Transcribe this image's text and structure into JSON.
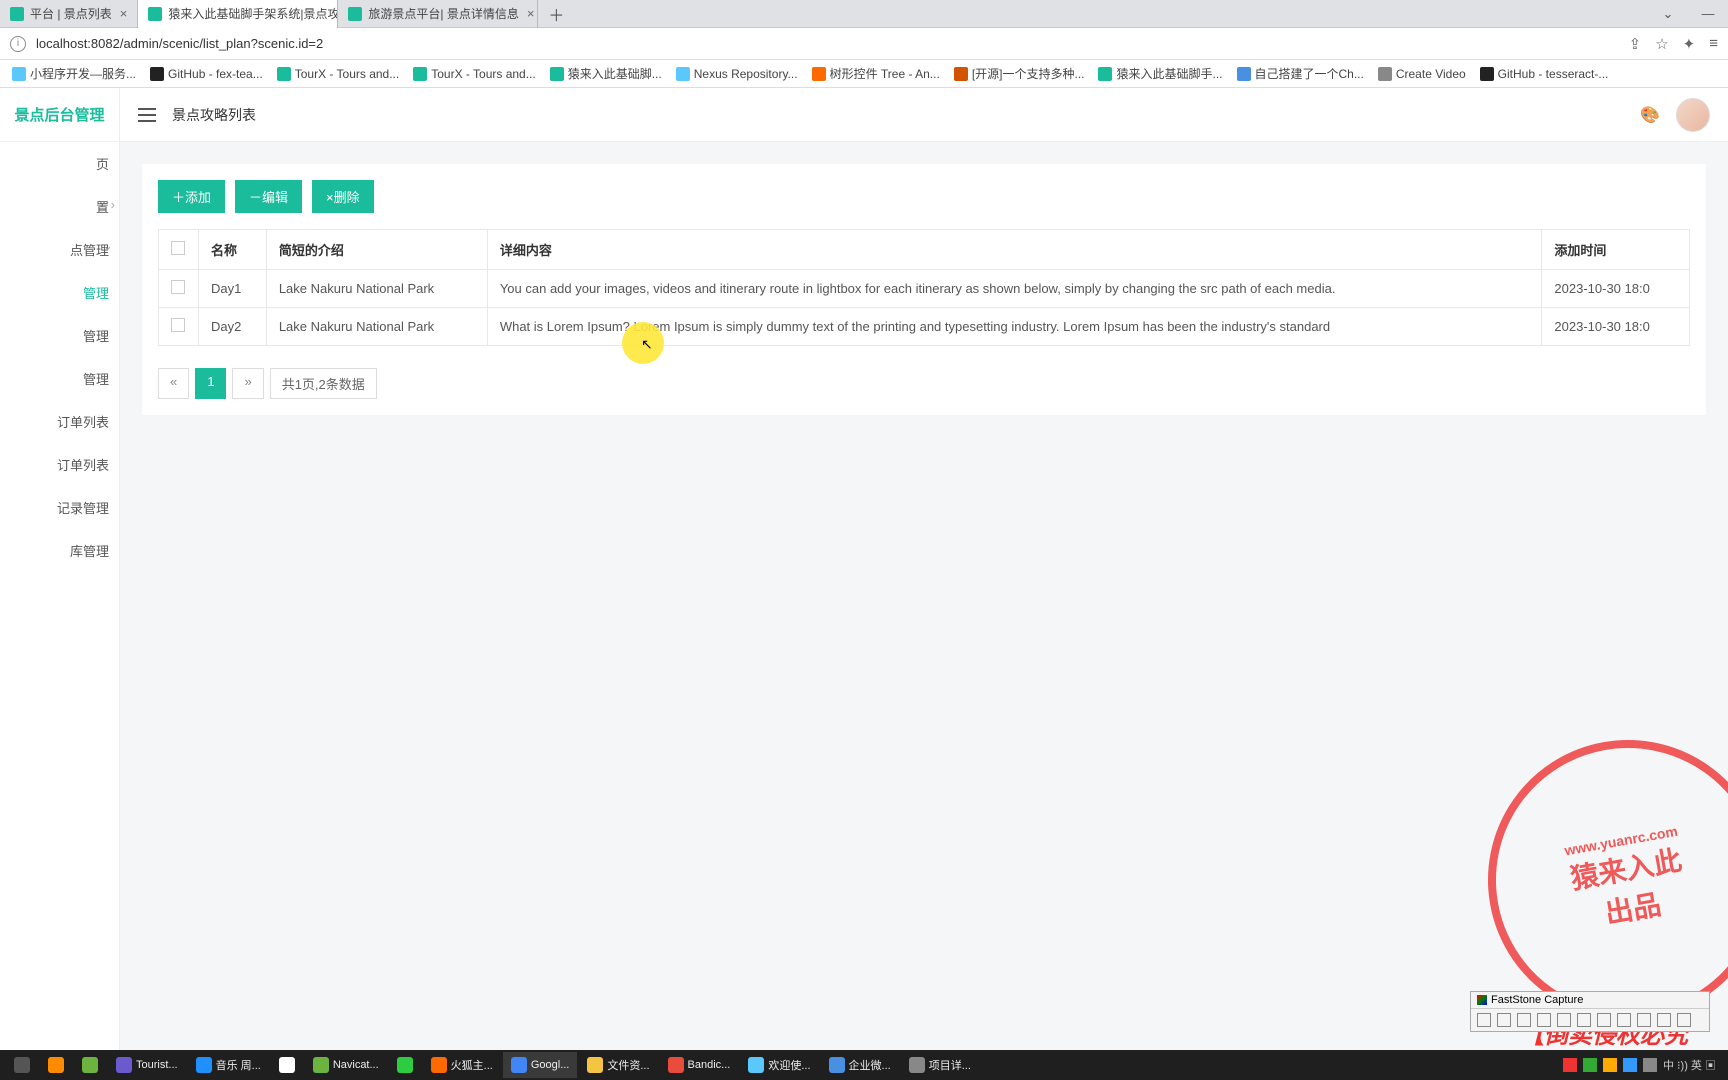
{
  "tabs": [
    {
      "title": "平台 | 景点列表",
      "active": false
    },
    {
      "title": "猿来入此基础脚手架系统|景点攻",
      "active": true
    },
    {
      "title": "旅游景点平台| 景点详情信息",
      "active": false
    }
  ],
  "url": "localhost:8082/admin/scenic/list_plan?scenic.id=2",
  "bookmarks": [
    {
      "label": "小程序开发—服务...",
      "color": "#5ac8fa"
    },
    {
      "label": "GitHub - fex-tea...",
      "color": "#222"
    },
    {
      "label": "TourX - Tours and...",
      "color": "#1abc9c"
    },
    {
      "label": "TourX - Tours and...",
      "color": "#1abc9c"
    },
    {
      "label": "猿来入此基础脚...",
      "color": "#1abc9c"
    },
    {
      "label": "Nexus Repository...",
      "color": "#5ac8fa"
    },
    {
      "label": "树形控件 Tree - An...",
      "color": "#ff6a00"
    },
    {
      "label": "[开源]一个支持多种...",
      "color": "#d35400"
    },
    {
      "label": "猿来入此基础脚手...",
      "color": "#1abc9c"
    },
    {
      "label": "自己搭建了一个Ch...",
      "color": "#4a90e2"
    },
    {
      "label": "Create Video",
      "color": "#888"
    },
    {
      "label": "GitHub - tesseract-...",
      "color": "#222"
    }
  ],
  "logo": "景点后台管理",
  "breadcrumb": "景点攻略列表",
  "sidebar": {
    "items": [
      {
        "label": "页",
        "sub": false
      },
      {
        "label": "置",
        "sub": false,
        "hasSub": true
      },
      {
        "label": "点管理",
        "sub": false,
        "hasSub": true,
        "open": true
      },
      {
        "label": "管理",
        "sub": true,
        "active": true
      },
      {
        "label": "管理",
        "sub": true
      },
      {
        "label": "管理",
        "sub": true
      },
      {
        "label": "订单列表",
        "sub": true
      },
      {
        "label": "订单列表",
        "sub": true
      },
      {
        "label": "记录管理",
        "sub": true
      },
      {
        "label": "库管理",
        "sub": true
      }
    ]
  },
  "buttons": {
    "add": "＋添加",
    "edit": "－编辑",
    "del": "×删除"
  },
  "table": {
    "headers": [
      "",
      "名称",
      "简短的介绍",
      "详细内容",
      "添加时间"
    ],
    "rows": [
      {
        "name": "Day1",
        "intro": "Lake Nakuru National Park",
        "detail": "You can add your images, videos and itinerary route in lightbox for each itinerary as shown below, simply by changing the src path of each media.",
        "time": "2023-10-30 18:0"
      },
      {
        "name": "Day2",
        "intro": "Lake Nakuru National Park",
        "detail": "What is Lorem Ipsum? Lorem Ipsum is simply dummy text of the printing and typesetting industry. Lorem Ipsum has been the industry's standard",
        "time": "2023-10-30 18:0"
      }
    ]
  },
  "pager": {
    "prev": "«",
    "current": "1",
    "next": "»",
    "info": "共1页,2条数据"
  },
  "faststone": "FastStone Capture",
  "stamp": {
    "site": "www.yuanrc.com",
    "main": "猿来入此",
    "sub": "出品"
  },
  "redtext": "【倒卖侵权必究",
  "taskbar": [
    {
      "label": "",
      "color": "#ff8c00"
    },
    {
      "label": "",
      "color": "#6db33f"
    },
    {
      "label": "Tourist...",
      "color": "#6a5acd"
    },
    {
      "label": "音乐 周...",
      "color": "#1e90ff"
    },
    {
      "label": "",
      "color": "#fff"
    },
    {
      "label": "Navicat...",
      "color": "#6db33f"
    },
    {
      "label": "",
      "color": "#2ecc40"
    },
    {
      "label": "火狐主...",
      "color": "#ff6a00"
    },
    {
      "label": "Googl...",
      "color": "#4285f4",
      "active": true
    },
    {
      "label": "文件资...",
      "color": "#f4c542"
    },
    {
      "label": "Bandic...",
      "color": "#e74c3c"
    },
    {
      "label": "欢迎使...",
      "color": "#5ac8fa"
    },
    {
      "label": "企业微...",
      "color": "#4a90e2"
    },
    {
      "label": "项目详...",
      "color": "#888"
    }
  ],
  "tray_text": "中 ⁝)) 英 ▣"
}
